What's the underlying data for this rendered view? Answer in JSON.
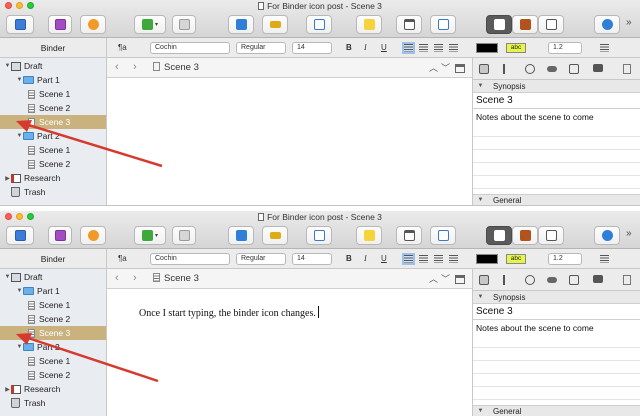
{
  "windows": [
    {
      "id": "before",
      "title": "For Binder icon post - Scene 3",
      "binder_header": "Binder",
      "format": {
        "paragraph_style": "¶a",
        "font": "Cochin",
        "weight": "Regular",
        "size": "14",
        "bold": "B",
        "italic": "I",
        "underline": "U",
        "highlight": "abc",
        "line_spacing": "1.2"
      },
      "binder": {
        "draft": "Draft",
        "part1": "Part 1",
        "part1_scenes": [
          "Scene 1",
          "Scene 2",
          "Scene 3"
        ],
        "part2": "Part 2",
        "part2_scenes": [
          "Scene 1",
          "Scene 2"
        ],
        "research": "Research",
        "trash": "Trash"
      },
      "editor": {
        "header_title": "Scene 3",
        "body": ""
      },
      "inspector": {
        "synopsis_header": "Synopsis",
        "title": "Scene 3",
        "notes": "Notes about the scene to come",
        "general_header": "General"
      }
    },
    {
      "id": "after",
      "title": "For Binder icon post - Scene 3",
      "binder_header": "Binder",
      "format": {
        "paragraph_style": "¶a",
        "font": "Cochin",
        "weight": "Regular",
        "size": "14",
        "bold": "B",
        "italic": "I",
        "underline": "U",
        "highlight": "abc",
        "line_spacing": "1.2"
      },
      "binder": {
        "draft": "Draft",
        "part1": "Part 1",
        "part1_scenes": [
          "Scene 1",
          "Scene 2",
          "Scene 3"
        ],
        "part2": "Part 2",
        "part2_scenes": [
          "Scene 1",
          "Scene 2"
        ],
        "research": "Research",
        "trash": "Trash"
      },
      "editor": {
        "header_title": "Scene 3",
        "body": "Once I start typing, the binder icon changes."
      },
      "inspector": {
        "synopsis_header": "Synopsis",
        "title": "Scene 3",
        "notes": "Notes about the scene to come",
        "general_header": "General"
      }
    }
  ],
  "colors": {
    "selection": "#c9b27e",
    "annotation_arrow": "#d63a2f",
    "binder_bg": "#e9ecf1",
    "folder": "#6cb0ea"
  }
}
